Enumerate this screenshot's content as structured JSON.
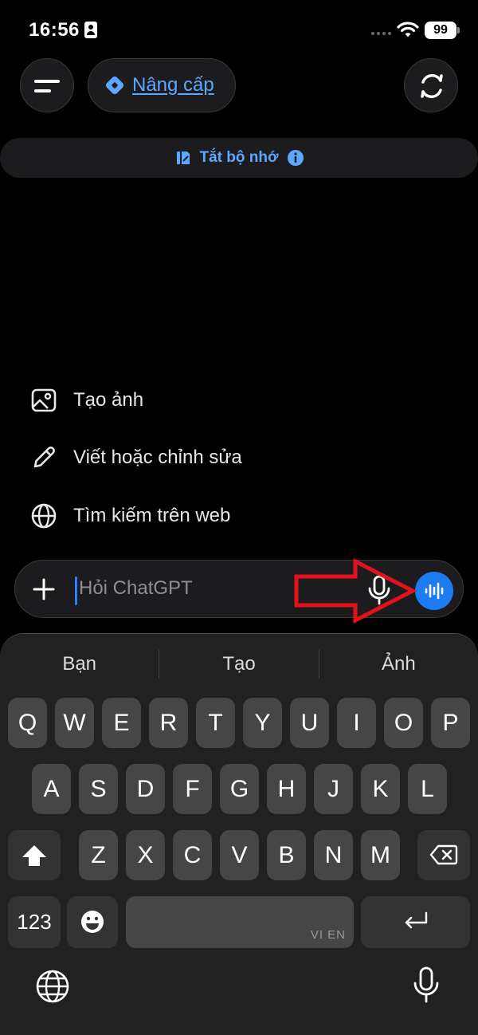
{
  "status_bar": {
    "time": "16:56",
    "battery": "99"
  },
  "header": {
    "upgrade_label": "Nâng cấp",
    "menu_icon": "hamburger-icon",
    "new_chat_icon": "new-chat-icon"
  },
  "memory_banner": {
    "label": "Tắt bộ nhớ"
  },
  "suggestions": [
    {
      "label": "Tạo ảnh",
      "icon": "image-icon"
    },
    {
      "label": "Viết hoặc chỉnh sửa",
      "icon": "pencil-icon"
    },
    {
      "label": "Tìm kiếm trên web",
      "icon": "globe-icon"
    }
  ],
  "composer": {
    "placeholder": "Hỏi ChatGPT"
  },
  "keyboard": {
    "predictions": [
      "Bạn",
      "Tạo",
      "Ảnh"
    ],
    "row1": [
      "Q",
      "W",
      "E",
      "R",
      "T",
      "Y",
      "U",
      "I",
      "O",
      "P"
    ],
    "row2": [
      "A",
      "S",
      "D",
      "F",
      "G",
      "H",
      "J",
      "K",
      "L"
    ],
    "row3": [
      "Z",
      "X",
      "C",
      "V",
      "B",
      "N",
      "M"
    ],
    "numbers_label": "123",
    "space_lang": "VI EN"
  },
  "colors": {
    "accent": "#5ba8ff",
    "voice_button": "#1d7cf2",
    "annotation_arrow": "#e3111b"
  }
}
